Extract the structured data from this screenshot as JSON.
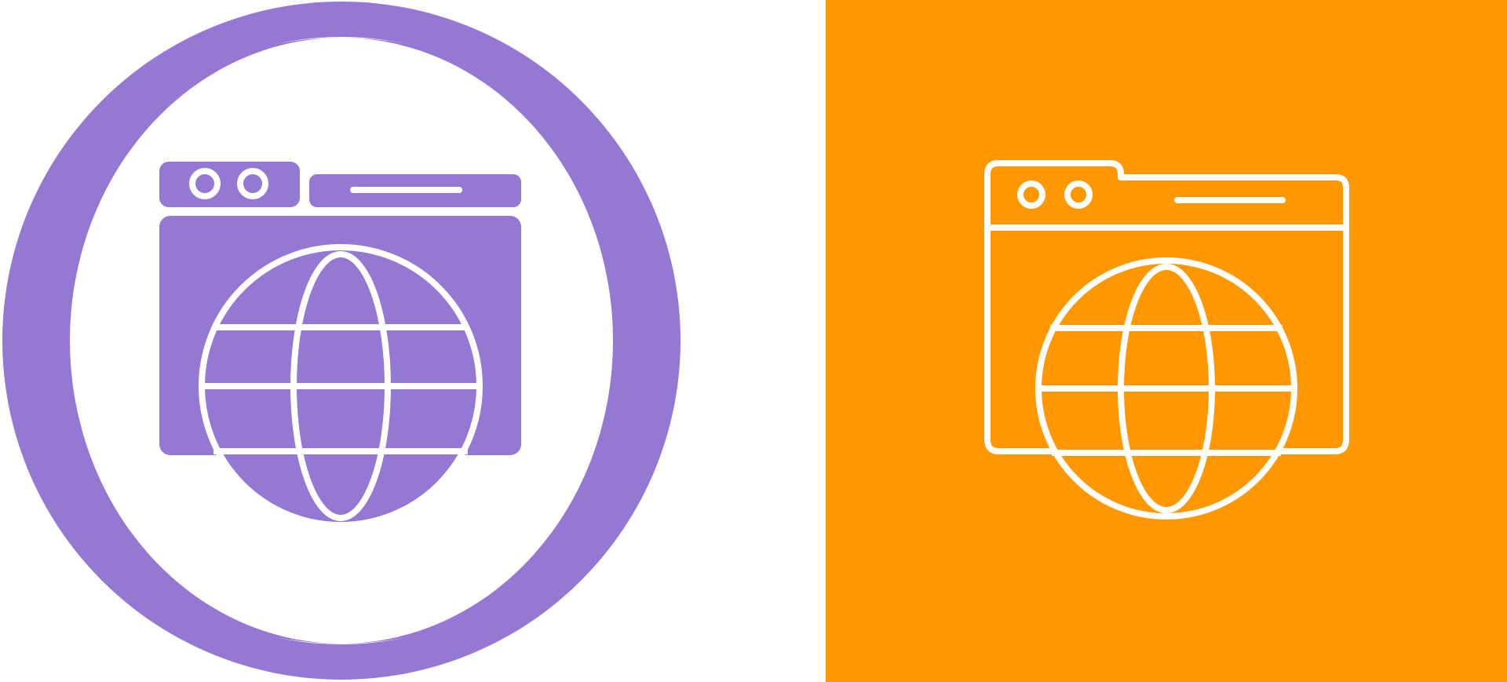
{
  "colors": {
    "background": "#ffffff",
    "accent_purple": "#9578d3",
    "accent_orange": "#fe9700",
    "stroke_white": "#ffffff"
  },
  "icons": {
    "left": "web-globe-glyph-icon",
    "right": "web-globe-line-icon"
  }
}
